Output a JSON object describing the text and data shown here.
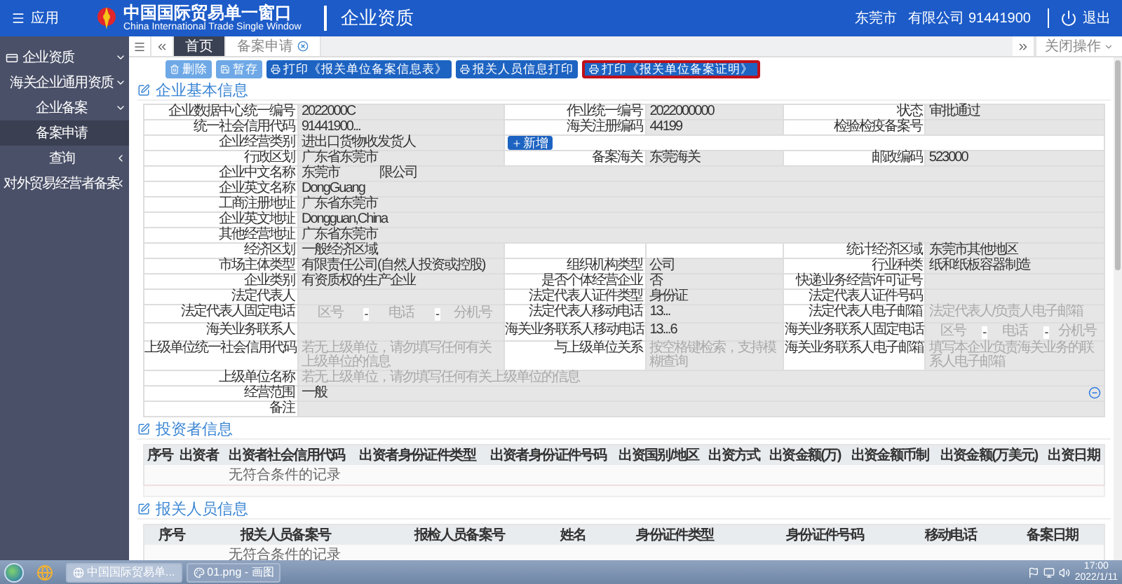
{
  "header": {
    "menu_label": "应用",
    "title_cn": "中国国际贸易单一窗口",
    "title_en": "China International Trade Single Window",
    "module": "企业资质",
    "user_name": "东莞市",
    "user_company": "有限公司 91441900",
    "logout": "退出"
  },
  "sidebar": {
    "items": [
      {
        "label": "企业资质",
        "expanded": true,
        "selected": false,
        "children": [
          {
            "label": "海关企业通用资质",
            "expanded": true,
            "selected": false,
            "children": [
              {
                "label": "企业备案",
                "expanded": true,
                "selected": false,
                "children": [
                  {
                    "label": "备案申请",
                    "selected": true
                  }
                ]
              }
            ]
          },
          {
            "label": "查询",
            "expanded": false,
            "selected": false
          },
          {
            "label": "对外贸易经营者备案",
            "expanded": false,
            "selected": false
          }
        ]
      }
    ]
  },
  "tabs": [
    {
      "label": "首页",
      "selected": true,
      "closable": false
    },
    {
      "label": "备案申请",
      "selected": false,
      "closable": true
    }
  ],
  "tab_menu": "关闭操作",
  "toolbar": [
    {
      "label": "删除",
      "kind": "delete",
      "highlighted": false
    },
    {
      "label": "暂存",
      "kind": "save",
      "highlighted": false
    },
    {
      "label": "打印《报关单位备案信息表》",
      "kind": "print",
      "highlighted": false
    },
    {
      "label": "报关人员信息打印",
      "kind": "print",
      "highlighted": false
    },
    {
      "label": "打印《报关单位备案证明》",
      "kind": "print",
      "highlighted": true
    }
  ],
  "basic_info": {
    "title": "企业基本信息",
    "rows": [
      [
        {
          "kind": "label",
          "text": "企业数据中心统一编号"
        },
        {
          "kind": "value",
          "text": "2022000C"
        },
        {
          "kind": "label",
          "text": "作业统一编号"
        },
        {
          "kind": "value",
          "text": "2022000000"
        },
        {
          "kind": "label",
          "text": "状态"
        },
        {
          "kind": "value",
          "text": "审批通过"
        }
      ],
      [
        {
          "kind": "label",
          "text": "统一社会信用代码"
        },
        {
          "kind": "value",
          "text": "91441900..."
        },
        {
          "kind": "label",
          "text": "海关注册编码"
        },
        {
          "kind": "value",
          "text": "44199"
        },
        {
          "kind": "label",
          "text": "检验检疫备案号"
        },
        {
          "kind": "value"
        }
      ],
      [
        {
          "kind": "label",
          "text": "企业经营类别"
        },
        {
          "kind": "value",
          "text": "进出口货物收发货人"
        },
        {
          "kind": "add",
          "text": "新增"
        }
      ],
      [
        {
          "kind": "label",
          "text": "行政区划"
        },
        {
          "kind": "value",
          "text": "广东省东莞市"
        },
        {
          "kind": "label",
          "text": "备案海关"
        },
        {
          "kind": "value",
          "text": "东莞海关"
        },
        {
          "kind": "label",
          "text": "邮政编码"
        },
        {
          "kind": "value",
          "text": "523000"
        }
      ],
      [
        {
          "kind": "label",
          "text": "企业中文名称"
        },
        {
          "kind": "value",
          "text": "东莞市                限公司"
        }
      ],
      [
        {
          "kind": "label",
          "text": "企业英文名称"
        },
        {
          "kind": "value",
          "text": "DongGuang"
        }
      ],
      [
        {
          "kind": "label",
          "text": "工商注册地址"
        },
        {
          "kind": "value",
          "text": "广东省东莞市"
        }
      ],
      [
        {
          "kind": "label",
          "text": "企业英文地址"
        },
        {
          "kind": "value",
          "text": "Dongguan,China"
        }
      ],
      [
        {
          "kind": "label",
          "text": "其他经营地址"
        },
        {
          "kind": "value",
          "text": "广东省东莞市"
        }
      ],
      [
        {
          "kind": "label",
          "text": "经济区划"
        },
        {
          "kind": "value",
          "text": "一般经济区域"
        },
        "",
        "",
        {
          "kind": "label",
          "text": "统计经济区域"
        },
        {
          "kind": "value",
          "text": "东莞市其他地区"
        }
      ],
      [
        {
          "kind": "label",
          "text": "市场主体类型"
        },
        {
          "kind": "value",
          "text": "有限责任公司(自然人投资或控股)"
        },
        {
          "kind": "label",
          "text": "组织机构类型"
        },
        {
          "kind": "value",
          "text": "公司"
        },
        {
          "kind": "label",
          "text": "行业种类"
        },
        {
          "kind": "value",
          "text": "纸和纸板容器制造"
        }
      ],
      [
        {
          "kind": "label",
          "text": "企业类别"
        },
        {
          "kind": "value",
          "text": "有资质权的生产企业"
        },
        {
          "kind": "label",
          "text": "是否个体经营企业"
        },
        {
          "kind": "value",
          "text": "否"
        },
        {
          "kind": "label",
          "text": "快递业务经营许可证号"
        },
        {
          "kind": "value"
        }
      ],
      [
        {
          "kind": "label",
          "text": "法定代表人"
        },
        {
          "kind": "value"
        },
        {
          "kind": "label",
          "text": "法定代表人证件类型"
        },
        {
          "kind": "value",
          "text": "身份证"
        },
        {
          "kind": "label",
          "text": "法定代表人证件号码"
        },
        {
          "kind": "value"
        }
      ],
      [
        {
          "kind": "label",
          "text": "法定代表人固定电话"
        },
        {
          "kind": "phone",
          "parts": [
            {
              "placeholder": "区号"
            },
            {
              "placeholder": "电话"
            },
            {
              "placeholder": "分机号"
            }
          ],
          "separator": "-"
        },
        {
          "kind": "label",
          "text": "法定代表人移动电话"
        },
        {
          "kind": "value",
          "text": "13..."
        },
        {
          "kind": "label",
          "text": "法定代表人电子邮箱"
        },
        {
          "kind": "hint",
          "placeholder": "法定代表人/负责人电子邮箱"
        }
      ],
      [
        {
          "kind": "label",
          "text": "海关业务联系人"
        },
        {
          "kind": "value"
        },
        {
          "kind": "label",
          "text": "海关业务联系人移动电话"
        },
        {
          "kind": "value",
          "text": "13...6"
        },
        {
          "kind": "label",
          "text": "海关业务联系人固定电话"
        },
        {
          "kind": "phone",
          "parts": [
            {
              "placeholder": "区号"
            },
            {
              "placeholder": "电话"
            },
            {
              "placeholder": "分机号"
            }
          ],
          "separator": "-"
        }
      ],
      [
        {
          "kind": "label",
          "text": "上级单位统一社会信用代码"
        },
        {
          "kind": "hint",
          "placeholder": "若无上级单位，请勿填写任何有关上级单位的信息"
        },
        {
          "kind": "label",
          "text": "与上级单位关系"
        },
        {
          "kind": "hint",
          "placeholder": "按空格键检索，支持模糊查询"
        },
        {
          "kind": "label",
          "text": "海关业务联系人电子邮箱"
        },
        {
          "kind": "hint",
          "placeholder": "填写本企业负责海关业务的联系人电子邮箱"
        }
      ],
      [
        {
          "kind": "label",
          "text": "上级单位名称"
        },
        {
          "kind": "hint",
          "placeholder": "若无上级单位，请勿填写任何有关上级单位的信息"
        }
      ],
      [
        {
          "kind": "label",
          "text": "经营范围"
        },
        {
          "kind": "value",
          "text": "一般",
          "removable": true
        }
      ],
      [
        {
          "kind": "label",
          "text": "备注"
        },
        {
          "kind": "value"
        }
      ]
    ]
  },
  "investors": {
    "title": "投资者信息",
    "columns": [
      "序号",
      "出资者",
      "出资者社会信用代码",
      "出资者身份证件类型",
      "出资者身份证件号码",
      "出资国别/地区",
      "出资方式",
      "出资金额(万)",
      "出资金额币制",
      "出资金额(万美元)",
      "出资日期"
    ],
    "empty_message": "无符合条件的记录"
  },
  "brokers": {
    "title": "报关人员信息",
    "columns": [
      "序号",
      "报关人员备案号",
      "报检人员备案号",
      "姓名",
      "身份证件类型",
      "身份证件号码",
      "移动电话",
      "备案日期"
    ],
    "empty_message": "无符合条件的记录"
  },
  "taskbar": {
    "tasks": [
      {
        "label": "中国国际贸易单...",
        "kind": "browser",
        "selected": true
      },
      {
        "label": "01.png - 画图",
        "kind": "paint",
        "selected": false
      }
    ],
    "time": "17:00",
    "date": "2022/1/11"
  }
}
